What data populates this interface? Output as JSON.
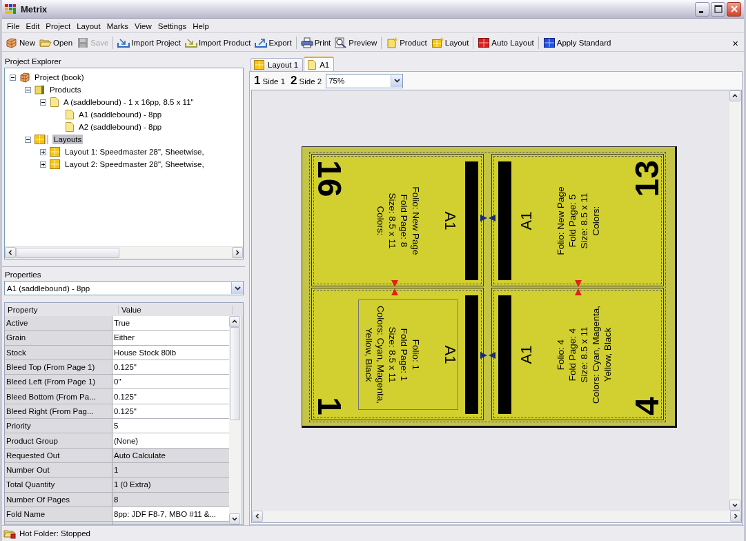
{
  "window": {
    "title": "Metrix"
  },
  "menu": [
    "File",
    "Edit",
    "Project",
    "Layout",
    "Marks",
    "View",
    "Settings",
    "Help"
  ],
  "toolbar": {
    "groups": [
      [
        {
          "label": "New",
          "disabled": false
        },
        {
          "label": "Open",
          "disabled": false
        },
        {
          "label": "Save",
          "disabled": true
        }
      ],
      [
        {
          "label": "Import Project",
          "disabled": false
        },
        {
          "label": "Import Product",
          "disabled": false
        },
        {
          "label": "Export",
          "disabled": false
        }
      ],
      [
        {
          "label": "Print",
          "disabled": false
        },
        {
          "label": "Preview",
          "disabled": false
        }
      ],
      [
        {
          "label": "Product",
          "disabled": false
        },
        {
          "label": "Layout",
          "disabled": false
        }
      ],
      [
        {
          "label": "Auto Layout",
          "disabled": false
        }
      ],
      [
        {
          "label": "Apply Standard",
          "disabled": false
        }
      ]
    ],
    "close": "×"
  },
  "explorer": {
    "title": "Project Explorer",
    "tree": [
      {
        "label": "Project  (book)",
        "kind": "project",
        "expanded": true,
        "selected": false,
        "children": [
          {
            "label": "Products",
            "kind": "group",
            "expanded": true,
            "selected": false,
            "children": [
              {
                "label": "A (saddlebound) - 1 x 16pp, 8.5 x 11\"",
                "kind": "document",
                "expanded": true,
                "selected": false,
                "children": [
                  {
                    "label": "A1 (saddlebound) - 8pp",
                    "kind": "document",
                    "selected": false
                  },
                  {
                    "label": "A2 (saddlebound) - 8pp",
                    "kind": "document",
                    "selected": false
                  }
                ]
              }
            ]
          },
          {
            "label": "Layouts",
            "kind": "layouts",
            "expanded": true,
            "selected": true,
            "children": [
              {
                "label": "Layout 1: Speedmaster 28\", Sheetwise,",
                "kind": "layout",
                "expanded": false,
                "selected": false
              },
              {
                "label": "Layout 2: Speedmaster 28\", Sheetwise,",
                "kind": "layout",
                "expanded": false,
                "selected": false
              }
            ]
          }
        ]
      }
    ]
  },
  "properties": {
    "title": "Properties",
    "selector": "A1 (saddlebound) - 8pp",
    "columns": [
      "Property",
      "Value"
    ],
    "rows": [
      {
        "name": "Active",
        "value": "True",
        "readonly": false
      },
      {
        "name": "Grain",
        "value": "Either",
        "readonly": false
      },
      {
        "name": "Stock",
        "value": "House Stock 80lb",
        "readonly": false
      },
      {
        "name": "Bleed Top (From Page 1)",
        "value": "0.125\"",
        "readonly": false
      },
      {
        "name": "Bleed Left (From Page 1)",
        "value": "0\"",
        "readonly": false
      },
      {
        "name": "Bleed Bottom (From Pa...",
        "value": "0.125\"",
        "readonly": false
      },
      {
        "name": "Bleed Right (From Pag...",
        "value": "0.125\"",
        "readonly": false
      },
      {
        "name": "Priority",
        "value": "5",
        "readonly": false
      },
      {
        "name": "Product Group",
        "value": "(None)",
        "readonly": false
      },
      {
        "name": "Requested Out",
        "value": "Auto Calculate",
        "readonly": true
      },
      {
        "name": "Number Out",
        "value": "1",
        "readonly": true
      },
      {
        "name": "Total Quantity",
        "value": "1  (0 Extra)",
        "readonly": true
      },
      {
        "name": "Number Of Pages",
        "value": "8",
        "readonly": true
      },
      {
        "name": "Fold Name",
        "value": "8pp: JDF F8-7, MBO #11 &...",
        "readonly": false
      }
    ]
  },
  "tabs": [
    {
      "label": "Layout 1",
      "kind": "layout",
      "selected": false
    },
    {
      "label": "A1",
      "kind": "document",
      "selected": true
    }
  ],
  "sides": [
    {
      "number": "1",
      "label": "Side 1"
    },
    {
      "number": "2",
      "label": "Side 2"
    }
  ],
  "zoom": "75%",
  "sheet": {
    "pages": [
      {
        "number": "16",
        "label": "A1",
        "lines": [
          "Folio: New Page",
          "Fold Page: 8",
          "Size: 8.5 x 11",
          "Colors:"
        ],
        "selected": false
      },
      {
        "number": "13",
        "label": "A1",
        "lines": [
          "Folio: New Page",
          "Fold Page: 5",
          "Size: 8.5 x 11",
          "Colors:"
        ],
        "selected": false
      },
      {
        "number": "1",
        "label": "A1",
        "lines": [
          "Folio: 1",
          "Fold Page: 1",
          "Size: 8.5 x 11",
          "Colors: Cyan, Magenta,",
          "Yellow, Black"
        ],
        "selected": true
      },
      {
        "number": "4",
        "label": "A1",
        "lines": [
          "Folio: 4",
          "Fold Page: 4",
          "Size: 8.5 x 11",
          "Colors: Cyan, Magenta,",
          "Yellow, Black"
        ],
        "selected": false
      }
    ]
  },
  "status_bar": {
    "text": "Hot Folder: Stopped"
  }
}
